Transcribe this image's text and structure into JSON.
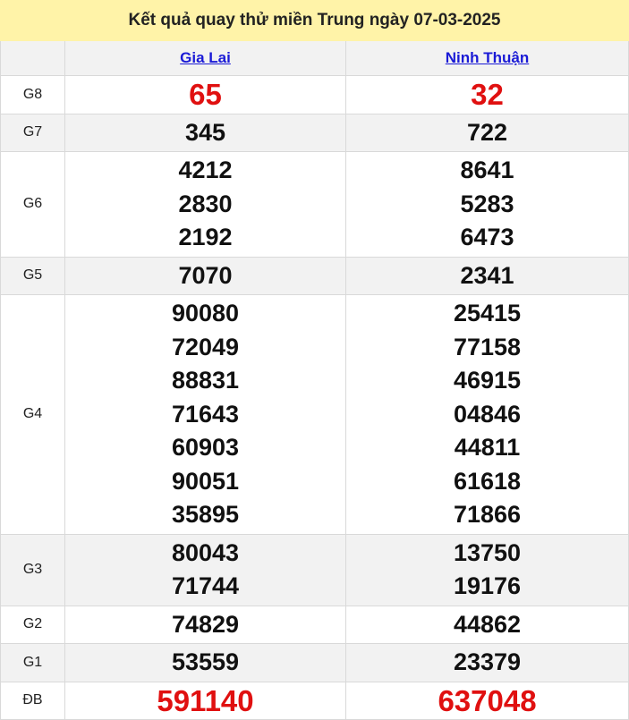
{
  "title": "Kết quả quay thử miền Trung ngày 07-03-2025",
  "provinces": [
    "Gia Lai",
    "Ninh Thuận"
  ],
  "prizes": [
    {
      "label": "G8",
      "values": [
        [
          "65"
        ],
        [
          "32"
        ]
      ],
      "red": true,
      "grey": false
    },
    {
      "label": "G7",
      "values": [
        [
          "345"
        ],
        [
          "722"
        ]
      ],
      "red": false,
      "grey": true
    },
    {
      "label": "G6",
      "values": [
        [
          "4212",
          "2830",
          "2192"
        ],
        [
          "8641",
          "5283",
          "6473"
        ]
      ],
      "red": false,
      "grey": false
    },
    {
      "label": "G5",
      "values": [
        [
          "7070"
        ],
        [
          "2341"
        ]
      ],
      "red": false,
      "grey": true
    },
    {
      "label": "G4",
      "values": [
        [
          "90080",
          "72049",
          "88831",
          "71643",
          "60903",
          "90051",
          "35895"
        ],
        [
          "25415",
          "77158",
          "46915",
          "04846",
          "44811",
          "61618",
          "71866"
        ]
      ],
      "red": false,
      "grey": false
    },
    {
      "label": "G3",
      "values": [
        [
          "80043",
          "71744"
        ],
        [
          "13750",
          "19176"
        ]
      ],
      "red": false,
      "grey": true
    },
    {
      "label": "G2",
      "values": [
        [
          "74829"
        ],
        [
          "44862"
        ]
      ],
      "red": false,
      "grey": false
    },
    {
      "label": "G1",
      "values": [
        [
          "53559"
        ],
        [
          "23379"
        ]
      ],
      "red": false,
      "grey": true
    },
    {
      "label": "ĐB",
      "values": [
        [
          "591140"
        ],
        [
          "637048"
        ]
      ],
      "red": true,
      "grey": false
    }
  ]
}
